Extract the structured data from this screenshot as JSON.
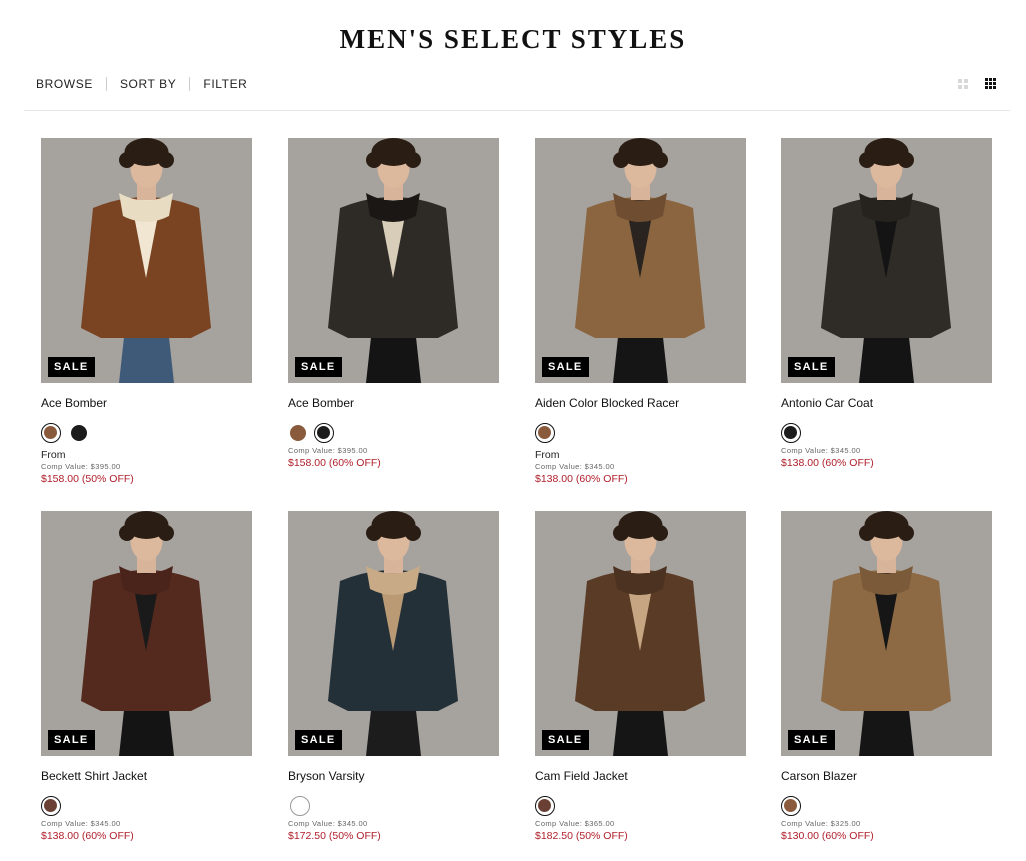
{
  "page": {
    "title": "MEN'S SELECT STYLES"
  },
  "toolbar": {
    "browse": "BROWSE",
    "sort_by": "SORT BY",
    "filter": "FILTER"
  },
  "view_options": [
    "grid-2-icon",
    "grid-4-icon"
  ],
  "badge_label": "SALE",
  "products": [
    {
      "name": "Ace Bomber",
      "from": "From",
      "comp": "Comp Value: $395.00",
      "price": "$158.00 (50% OFF)",
      "swatches": [
        "#8a5a3c",
        "#1c1c1c"
      ],
      "selected_swatch": 0,
      "jacket": "#7a4422",
      "collar": "#e8dcc3",
      "shirt": "#f0e6d2",
      "pants": "#3f5a78"
    },
    {
      "name": "Ace Bomber",
      "from": "",
      "comp": "Comp Value: $395.00",
      "price": "$158.00 (60% OFF)",
      "swatches": [
        "#8a5a3c",
        "#1c1c1c"
      ],
      "selected_swatch": 1,
      "jacket": "#2e2a26",
      "collar": "#1a1714",
      "shirt": "#d8cdb8",
      "pants": "#141414"
    },
    {
      "name": "Aiden Color Blocked Racer",
      "from": "From",
      "comp": "Comp Value: $345.00",
      "price": "$138.00 (60% OFF)",
      "swatches": [
        "#8a5a3c"
      ],
      "selected_swatch": 0,
      "jacket": "#8b6440",
      "collar": "#6e4d30",
      "shirt": "#2a2420",
      "pants": "#151515"
    },
    {
      "name": "Antonio Car Coat",
      "from": "",
      "comp": "Comp Value: $345.00",
      "price": "$138.00 (60% OFF)",
      "swatches": [
        "#1c1c1c"
      ],
      "selected_swatch": 0,
      "jacket": "#2f2b26",
      "collar": "#26221e",
      "shirt": "#141414",
      "pants": "#141414"
    },
    {
      "name": "Beckett Shirt Jacket",
      "from": "",
      "comp": "Comp Value: $345.00",
      "price": "$138.00 (60% OFF)",
      "swatches": [
        "#6a4034"
      ],
      "selected_swatch": 0,
      "jacket": "#552a1e",
      "collar": "#4a231a",
      "shirt": "#1a1a1a",
      "pants": "#141414"
    },
    {
      "name": "Bryson Varsity",
      "from": "",
      "comp": "Comp Value: $345.00",
      "price": "$172.50 (50% OFF)",
      "swatches": [
        "#ffffff"
      ],
      "selected_swatch": 0,
      "jacket": "#243038",
      "collar": "#c8ab86",
      "shirt": "#b99a74",
      "pants": "#1c1c1c"
    },
    {
      "name": "Cam Field Jacket",
      "from": "",
      "comp": "Comp Value: $365.00",
      "price": "$182.50 (50% OFF)",
      "swatches": [
        "#6a4034"
      ],
      "selected_swatch": 0,
      "jacket": "#5a3c26",
      "collar": "#4c3220",
      "shirt": "#c6a682",
      "pants": "#151515"
    },
    {
      "name": "Carson Blazer",
      "from": "",
      "comp": "Comp Value: $325.00",
      "price": "$130.00 (60% OFF)",
      "swatches": [
        "#8a5a3c"
      ],
      "selected_swatch": 0,
      "jacket": "#8d6a44",
      "collar": "#7a5a38",
      "shirt": "#161616",
      "pants": "#151515"
    }
  ]
}
